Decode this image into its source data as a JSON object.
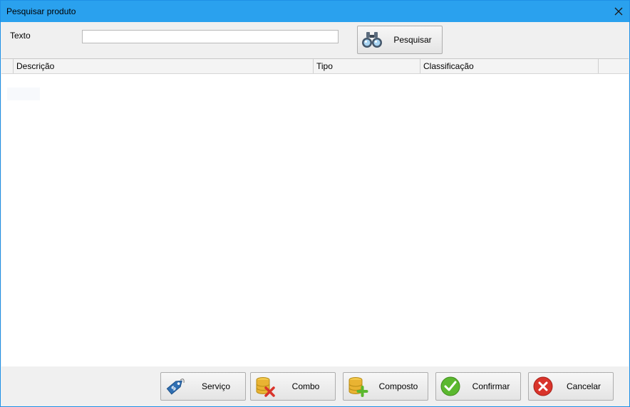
{
  "window": {
    "title": "Pesquisar produto"
  },
  "search": {
    "label": "Texto",
    "value": "",
    "button_label": "Pesquisar"
  },
  "grid": {
    "columns": [
      "Descrição",
      "Tipo",
      "Classificação"
    ],
    "rows": []
  },
  "footer": {
    "servico_label": "Serviço",
    "combo_label": "Combo",
    "composto_label": "Composto",
    "confirmar_label": "Confirmar",
    "cancelar_label": "Cancelar"
  },
  "icons": {
    "close": "close-icon",
    "search": "binoculars-icon",
    "servico": "price-tag-icon",
    "combo": "database-delete-icon",
    "composto": "database-add-icon",
    "confirmar": "checkmark-icon",
    "cancelar": "cancel-icon"
  },
  "colors": {
    "titlebar": "#2aa1ee",
    "confirm_green": "#5bb82f",
    "cancel_red": "#d9342b",
    "tag_blue": "#2f6fb3"
  }
}
